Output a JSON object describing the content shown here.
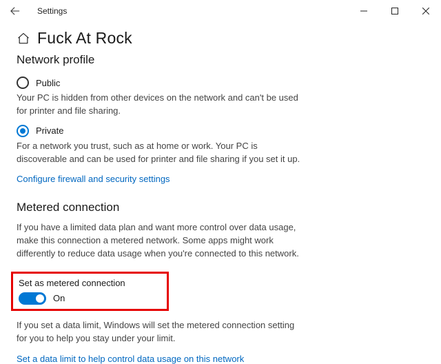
{
  "window": {
    "title": "Settings"
  },
  "page": {
    "title": "Fuck At Rock"
  },
  "networkProfile": {
    "heading": "Network profile",
    "public": {
      "label": "Public",
      "description": "Your PC is hidden from other devices on the network and can't be used for printer and file sharing."
    },
    "private": {
      "label": "Private",
      "description": "For a network you trust, such as at home or work. Your PC is discoverable and can be used for printer and file sharing if you set it up."
    },
    "firewallLink": "Configure firewall and security settings"
  },
  "metered": {
    "heading": "Metered connection",
    "description": "If you have a limited data plan and want more control over data usage, make this connection a metered network. Some apps might work differently to reduce data usage when you're connected to this network.",
    "toggleLabel": "Set as metered connection",
    "toggleState": "On",
    "dataLimitText": "If you set a data limit, Windows will set the metered connection setting for you to help you stay under your limit.",
    "dataLimitLink": "Set a data limit to help control data usage on this network"
  }
}
